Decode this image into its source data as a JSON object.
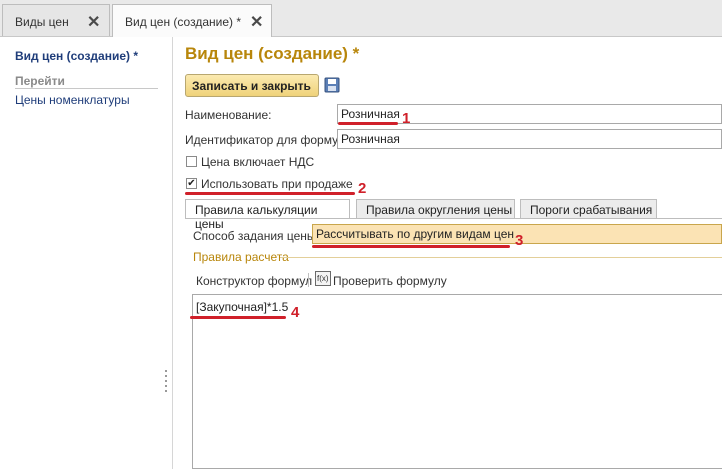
{
  "tabs": [
    {
      "label": "Виды цен"
    },
    {
      "label": "Вид цен (создание) *"
    }
  ],
  "sidebar": {
    "title": "Вид цен (создание) *",
    "section": "Перейти",
    "items": [
      {
        "label": "Цены номенклатуры"
      }
    ]
  },
  "form": {
    "title": "Вид цен (создание) *",
    "save_close_label": "Записать и закрыть",
    "name_label": "Наименование:",
    "name_value": "Розничная",
    "formula_id_label": "Идентификатор для формул:",
    "formula_id_value": "Розничная",
    "vat_label": "Цена включает НДС",
    "vat_checked": false,
    "use_in_sales_label": "Использовать при продаже",
    "use_in_sales_checked": true,
    "subtabs": [
      {
        "label": "Правила калькуляции цены"
      },
      {
        "label": "Правила округления цены"
      },
      {
        "label": "Пороги срабатывания"
      }
    ],
    "method_label": "Способ задания цены:",
    "method_value": "Рассчитывать по другим видам цен",
    "rules_group": "Правила расчета",
    "formula_builder": "Конструктор формул",
    "check_formula": "Проверить формулу",
    "check_icon_text": "f(x)",
    "formula_text": "[Закупочная]*1.5"
  },
  "annotations": [
    "1",
    "2",
    "3",
    "4"
  ],
  "colors": {
    "accent": "#b8860b",
    "annotation": "#d0202a",
    "button": "#f3dc8f",
    "highlight_field": "#fbe3b4"
  }
}
